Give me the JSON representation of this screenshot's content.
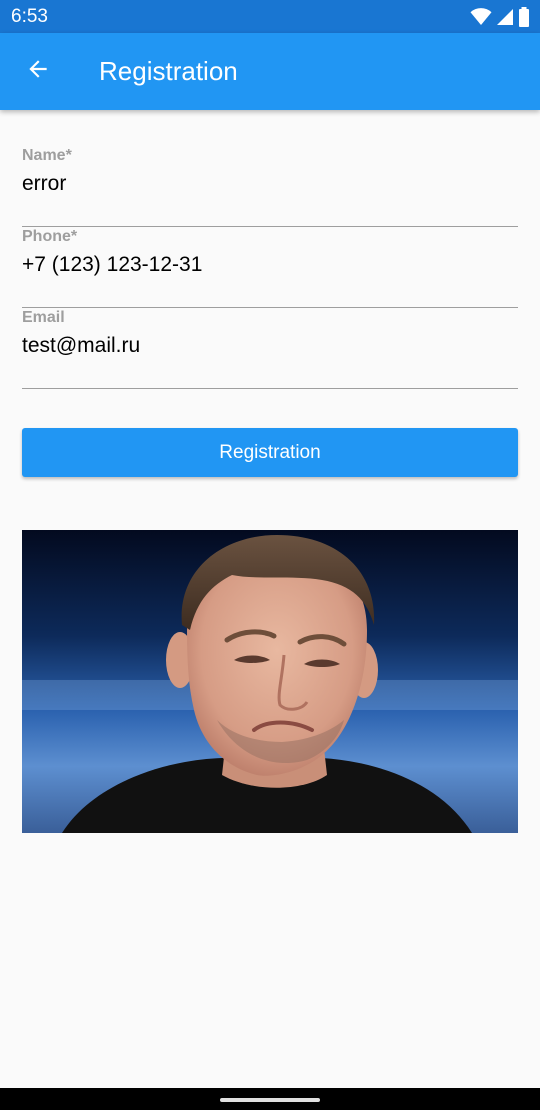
{
  "status_bar": {
    "time": "6:53",
    "icons": [
      "wifi-icon",
      "signal-icon",
      "battery-icon"
    ]
  },
  "app_bar": {
    "back_icon": "arrow-back-icon",
    "title": "Registration"
  },
  "form": {
    "name": {
      "label": "Name*",
      "value": "error"
    },
    "phone": {
      "label": "Phone*",
      "value": "+7 (123) 123-12-31"
    },
    "email": {
      "label": "Email",
      "value": "test@mail.ru"
    }
  },
  "register_button": {
    "label": "Registration"
  },
  "photo": {
    "description_icon": "person-photo"
  },
  "colors": {
    "status_bar": "#1976d2",
    "app_bar": "#2196f3",
    "button": "#2196f3",
    "background": "#fafafa",
    "label": "#9e9e9e"
  }
}
